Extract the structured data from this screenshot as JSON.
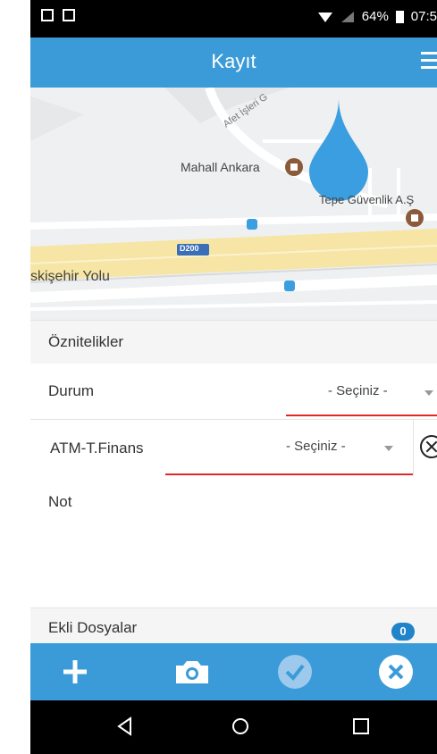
{
  "status_bar": {
    "battery": "64%",
    "time": "07:5"
  },
  "app_bar": {
    "title": "Kayıt"
  },
  "map": {
    "labels": {
      "afet": "Afet İşleri G",
      "mall": "Mahall Ankara",
      "tepe": "Tepe Güvenlik A.Ş",
      "road_badge": "D200",
      "road_name": "skişehir Yolu"
    }
  },
  "form": {
    "attributes_header": "Öznitelikler",
    "durum": {
      "label": "Durum",
      "value": "- Seçiniz -"
    },
    "atm": {
      "label": "ATM-T.Finans",
      "value": "- Seçiniz -"
    },
    "note": {
      "label": "Not"
    },
    "attachments": {
      "label": "Ekli Dosyalar",
      "count": "0"
    }
  },
  "toolbar": {
    "buttons": [
      "add-icon",
      "camera-icon",
      "check-icon",
      "close-icon"
    ]
  },
  "colors": {
    "primary": "#3b9bd8",
    "accent_red": "#e0282a",
    "badge": "#1f84c9"
  }
}
